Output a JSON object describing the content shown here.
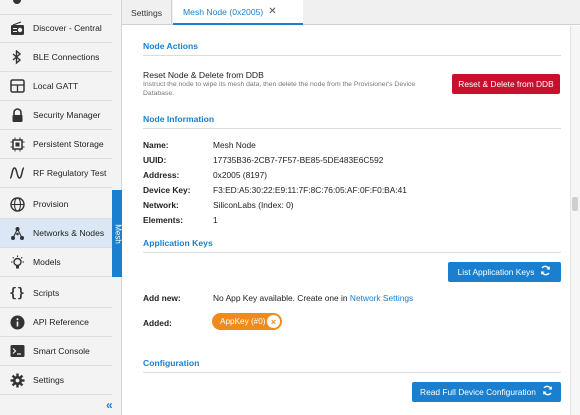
{
  "sidebar": {
    "items": [
      {
        "label": "Discover - Central",
        "icon": "radio-icon"
      },
      {
        "label": "BLE Connections",
        "icon": "bluetooth-icon"
      },
      {
        "label": "Local GATT",
        "icon": "table-icon"
      },
      {
        "label": "Security Manager",
        "icon": "lock-icon"
      },
      {
        "label": "Persistent Storage",
        "icon": "chip-icon"
      },
      {
        "label": "RF Regulatory Test",
        "icon": "wave-icon"
      },
      {
        "label": "Provision",
        "icon": "globe-icon"
      },
      {
        "label": "Networks & Nodes",
        "icon": "network-icon"
      },
      {
        "label": "Models",
        "icon": "bulb-icon"
      },
      {
        "label": "Scripts",
        "icon": "braces-icon"
      },
      {
        "label": "API Reference",
        "icon": "info-icon"
      },
      {
        "label": "Smart Console",
        "icon": "terminal-icon"
      },
      {
        "label": "Settings",
        "icon": "gear-icon"
      }
    ],
    "active_index": 7,
    "group_label": "Mesh",
    "collapse_glyph": "«"
  },
  "tabs": [
    {
      "label": "Settings"
    },
    {
      "label": "Mesh Node (0x2005)",
      "close": "✕"
    }
  ],
  "node_actions": {
    "title": "Node Actions",
    "reset_title": "Reset Node & Delete from DDB",
    "reset_desc": "Instruct the node to wipe its mesh data, then delete the node from the Provisioner's Device Database.",
    "reset_button": "Reset & Delete from DDB"
  },
  "node_information": {
    "title": "Node Information",
    "name_label": "Name:",
    "name_value": "Mesh Node",
    "uuid_label": "UUID:",
    "uuid_value": "17735B36-2CB7-7F57-BE85-5DE483E6C592",
    "address_label": "Address:",
    "address_value": "0x2005 (8197)",
    "devkey_label": "Device Key:",
    "devkey_value": "F3:ED:A5:30:22:E9:11:7F:8C:76:05:AF:0F:F0:BA:41",
    "network_label": "Network:",
    "network_value": "SiliconLabs (Index: 0)",
    "elements_label": "Elements:",
    "elements_value": "1"
  },
  "application_keys": {
    "title": "Application Keys",
    "list_button": "List Application Keys",
    "add_new_label": "Add new:",
    "add_new_text": "No App Key available. Create one in",
    "add_new_link": "Network Settings",
    "added_label": "Added:",
    "added_chip": "AppKey (#0)"
  },
  "configuration": {
    "title": "Configuration",
    "read_button": "Read Full Device Configuration"
  },
  "colors": {
    "accent": "#1a7fcf",
    "danger": "#c8102e",
    "chip": "#f08a1c"
  }
}
